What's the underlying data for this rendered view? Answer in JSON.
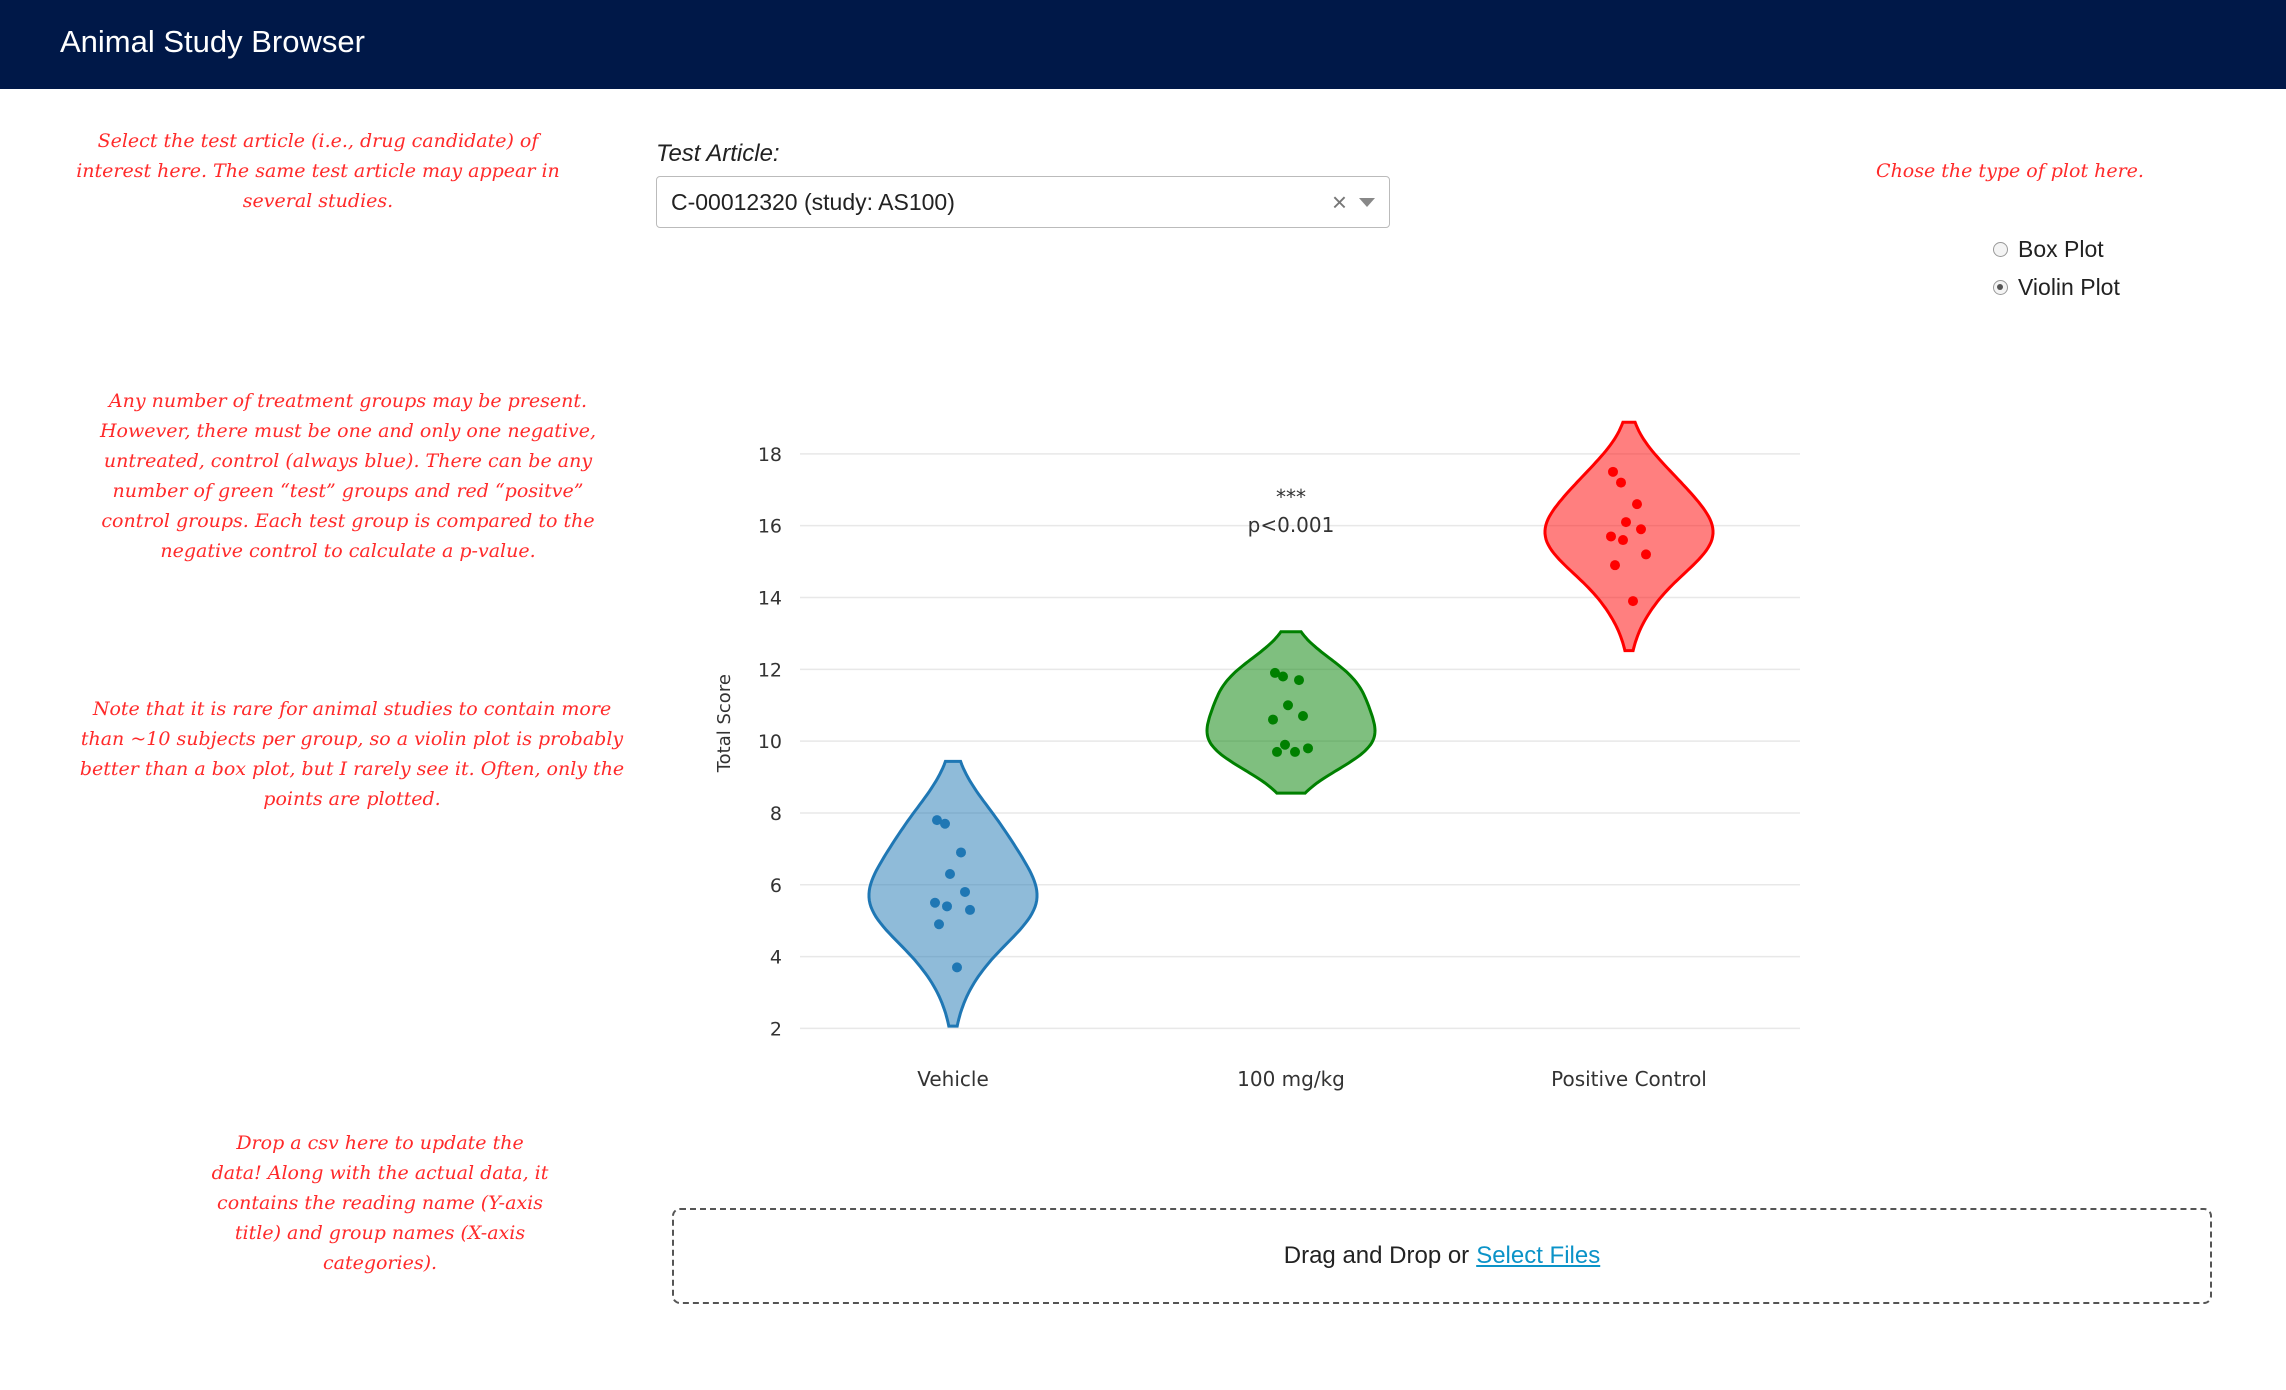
{
  "app": {
    "title": "Animal Study Browser"
  },
  "notes": {
    "select": "Select the test article (i.e., drug candidate) of interest here. The same test article may appear in several studies.",
    "plot_type": "Chose the type of plot here.",
    "groups": "Any number of treatment groups may be present. However, there must be one and only one negative, untreated, control (always blue). There can be any number of green “test” groups and red “positve” control groups. Each test group is compared to the negative control to calculate a p-value.",
    "violin": "Note that it is rare for animal studies to contain more than ~10 subjects per group, so a violin plot is probably better than a box plot, but I rarely see it. Often, only the points are plotted.",
    "drop": "Drop a csv here to update the data! Along with the actual data, it contains the reading name (Y-axis title) and group names (X-axis categories)."
  },
  "test_article": {
    "label": "Test Article:",
    "value": "C-00012320 (study: AS100)",
    "clear_symbol": "×"
  },
  "plot_type": {
    "options": [
      "Box Plot",
      "Violin Plot"
    ],
    "selected": "Violin Plot"
  },
  "dropzone": {
    "text": "Drag and Drop or",
    "link": "Select Files"
  },
  "chart_data": {
    "type": "violin",
    "ylabel": "Total Score",
    "ylim": [
      2,
      19
    ],
    "yticks": [
      2,
      4,
      6,
      8,
      10,
      12,
      14,
      16,
      18
    ],
    "grid": true,
    "categories": [
      "Vehicle",
      "100 mg/kg",
      "Positive Control"
    ],
    "series": [
      {
        "category": "Vehicle",
        "color": "#1f77b4",
        "values": [
          7.8,
          7.7,
          6.9,
          6.3,
          5.8,
          5.5,
          5.4,
          5.3,
          4.9,
          3.7
        ]
      },
      {
        "category": "100 mg/kg",
        "color": "#008000",
        "values": [
          11.9,
          11.8,
          11.7,
          11.0,
          10.7,
          10.6,
          9.9,
          9.8,
          9.7,
          9.7
        ],
        "annotation": [
          "***",
          "p<0.001"
        ]
      },
      {
        "category": "Positive Control",
        "color": "#ff0000",
        "values": [
          17.5,
          17.2,
          16.6,
          16.1,
          15.9,
          15.7,
          15.6,
          15.2,
          14.9,
          13.9
        ]
      }
    ]
  }
}
